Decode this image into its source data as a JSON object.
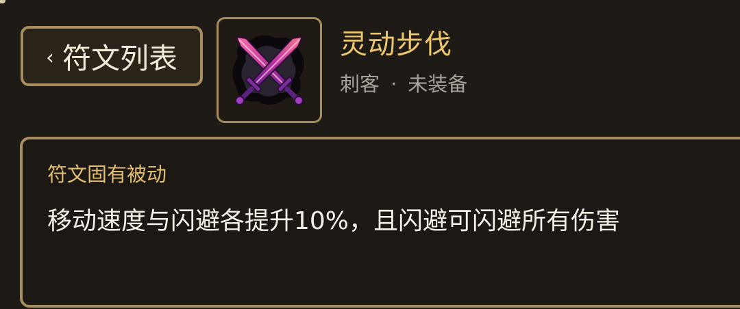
{
  "header": {
    "back_label": "符文列表",
    "back_chevron": "‹"
  },
  "rune": {
    "icon": "crossed-swords-icon",
    "title": "灵动步伐",
    "class": "刺客",
    "separator": "·",
    "status": "未装备"
  },
  "passive": {
    "label": "符文固有被动",
    "description": "移动速度与闪避各提升10%，且闪避可闪避所有伤害"
  },
  "colors": {
    "accent_gold": "#ecc770",
    "border_gold": "#a88d5f",
    "background": "#1e1a15",
    "icon_purple": "#9b35c9",
    "icon_pink": "#e0568a"
  }
}
